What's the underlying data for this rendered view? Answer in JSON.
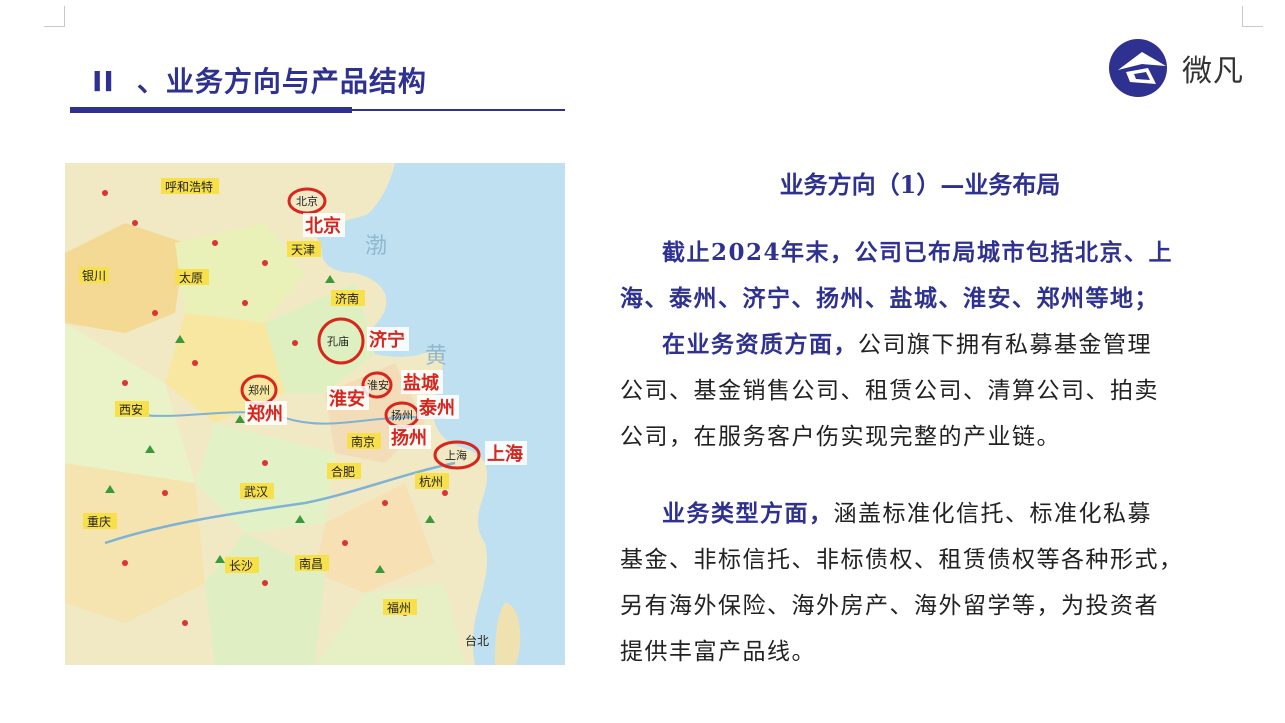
{
  "header": {
    "section_number": "II",
    "title": "、业务方向与产品结构",
    "logo_text": "微凡"
  },
  "map": {
    "cities_circled": [
      "北京",
      "济宁",
      "郑州",
      "淮安",
      "盐城",
      "泰州",
      "扬州",
      "上海"
    ],
    "labels": {
      "huhehaote": "呼和浩特",
      "beijing_dot": "北京",
      "beijing": "北京",
      "tianjin": "天津",
      "taiyuan": "太原",
      "yinchuan": "银川",
      "jinan": "济南",
      "qufu": "孔庙",
      "jining": "济宁",
      "zhengzhou_dot": "郑州",
      "zhengzhou": "郑州",
      "huaian_dot": "淮安",
      "huaian": "淮安",
      "yancheng": "盐城",
      "taizhou": "泰州",
      "yangzhou_dot": "扬州",
      "yangzhou": "扬州",
      "nanjing": "南京",
      "shanghai_dot": "上海",
      "shanghai": "上海",
      "hangzhou": "杭州",
      "wuhan": "武汉",
      "changsha": "长沙",
      "nanchang": "南昌",
      "fuzhou": "福州",
      "chongqing": "重庆",
      "xian": "西安",
      "hefei": "合肥",
      "taibei": "台北",
      "sea_bohai": "渤",
      "sea_huang": "黄"
    }
  },
  "content": {
    "heading": "业务方向（1）—业务布局",
    "para1_lines": [
      "截止2024年末，公司已布局城市包括北京、上",
      "海、泰州、济宁、扬州、盐城、淮安、郑州等地；"
    ],
    "para1_rest_highlight": "在业务资质方面，",
    "para1_rest_line1": "公司旗下拥有私募基金管理",
    "para1_rest_line2": "公司、基金销售公司、租赁公司、清算公司、拍卖",
    "para1_rest_line3": "公司，在服务客户伤实现完整的产业链。",
    "para2_highlight": "业务类型方面，",
    "para2_line1": "涵盖标准化信托、标准化私募",
    "para2_line2": "基金、非标信托、非标债权、租赁债权等各种形式，",
    "para2_line3": "另有海外保险、海外房产、海外留学等，为投资者",
    "para2_line4": "提供丰富产品线。"
  }
}
